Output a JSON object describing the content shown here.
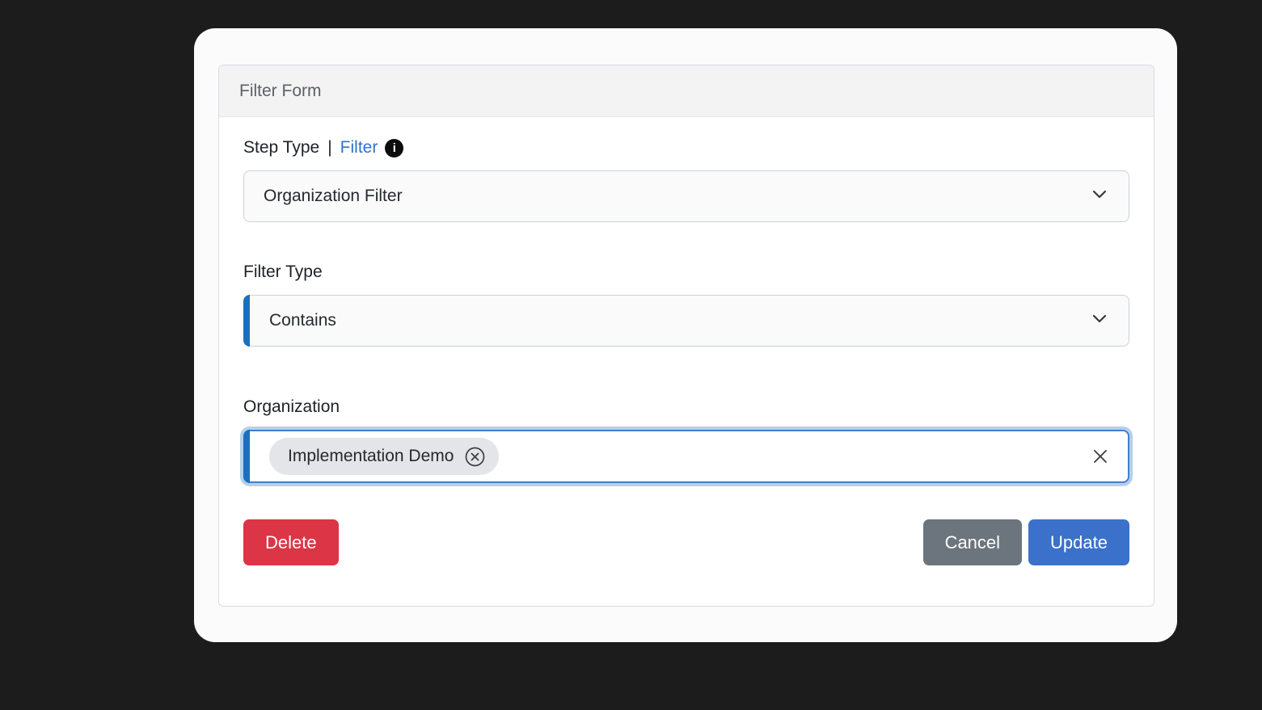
{
  "modal": {
    "header": {
      "title": "Filter Form"
    }
  },
  "form": {
    "step_type": {
      "label": "Step Type",
      "separator": "|",
      "link_label": "Filter",
      "info_glyph": "i",
      "value": "Organization Filter"
    },
    "filter_type": {
      "label": "Filter Type",
      "value": "Contains"
    },
    "organization": {
      "label": "Organization",
      "chips": [
        {
          "label": "Implementation Demo"
        }
      ]
    }
  },
  "buttons": {
    "delete_label": "Delete",
    "cancel_label": "Cancel",
    "update_label": "Update"
  },
  "colors": {
    "page_background": "#1c1c1c",
    "accent_blue": "#1c6fbe",
    "focus_border_blue": "#3f80d0",
    "link_blue": "#2f74d0",
    "danger_red": "#dc3545",
    "secondary_gray": "#6c757d",
    "primary_blue": "#3b71ca",
    "chip_gray": "#e4e5e8",
    "header_gray": "#f3f3f4"
  }
}
